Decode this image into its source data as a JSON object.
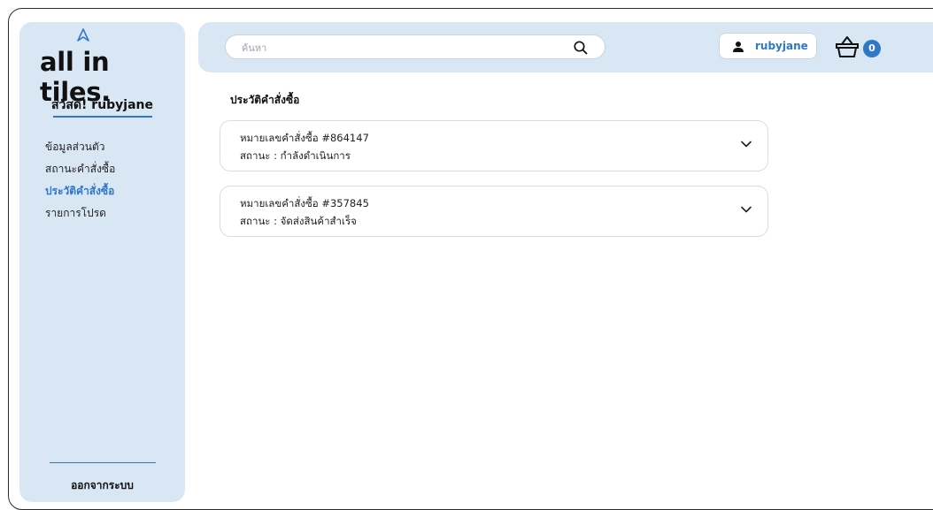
{
  "brand": {
    "logo_text": "all in tiles."
  },
  "sidebar": {
    "greeting": "สวัสดี! rubyjane",
    "items": [
      {
        "label": "ข้อมูลส่วนตัว",
        "active": false
      },
      {
        "label": "สถานะคำสั่งซื้อ",
        "active": false
      },
      {
        "label": "ประวัติคำสั่งซื้อ",
        "active": true
      },
      {
        "label": "รายการโปรด",
        "active": false
      }
    ],
    "logout_label": "ออกจากระบบ"
  },
  "header": {
    "search": {
      "placeholder": "ค้นหา",
      "value": ""
    },
    "username": "rubyjane",
    "cart_count": "0"
  },
  "main": {
    "title": "ประวัติคำสั่งซื้อ",
    "orders": [
      {
        "number": "หมายเลขคำสั่งซื้อ #864147",
        "status": "สถานะ : กำลังดำเนินการ"
      },
      {
        "number": "หมายเลขคำสั่งซื้อ #357845",
        "status": "สถานะ : จัดส่งสินค้าสำเร็จ"
      }
    ]
  },
  "colors": {
    "accent": "#2f78c8",
    "panel": "#d9e7f5"
  }
}
